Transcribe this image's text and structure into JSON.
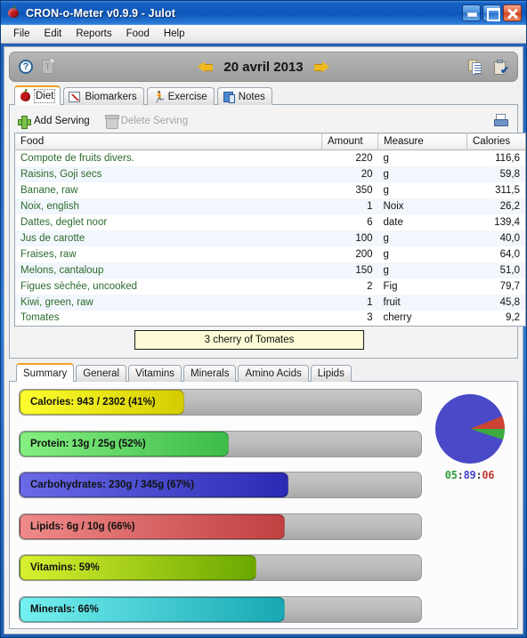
{
  "window": {
    "title": "CRON-o-Meter v0.9.9 - Julot",
    "icon": "apple-icon",
    "buttons": {
      "minimize": "minimize",
      "maximize": "maximize",
      "close": "close"
    }
  },
  "menubar": {
    "items": [
      "File",
      "Edit",
      "Reports",
      "Food",
      "Help"
    ]
  },
  "toolbar": {
    "help_icon": "?",
    "note_icon": "T",
    "prev_label": "previous-day",
    "next_label": "next-day",
    "date": "20 avril 2013",
    "copy_icon": "copy-icon",
    "paste_icon": "paste-icon"
  },
  "top_tabs": [
    {
      "label": "Diet",
      "icon": "apple-icon",
      "active": true
    },
    {
      "label": "Biomarkers",
      "icon": "chart-icon",
      "active": false
    },
    {
      "label": "Exercise",
      "icon": "runner-icon",
      "active": false
    },
    {
      "label": "Notes",
      "icon": "note-icon",
      "active": false
    }
  ],
  "serving_toolbar": {
    "add_label": "Add Serving",
    "delete_label": "Delete Serving",
    "delete_enabled": false,
    "print_icon": "print-icon"
  },
  "food_table": {
    "columns": [
      "Food",
      "Amount",
      "Measure",
      "Calories"
    ],
    "rows": [
      {
        "food": "Compote de fruits divers.",
        "amount": "220",
        "measure": "g",
        "calories": "116,6"
      },
      {
        "food": "Raisins, Goji secs",
        "amount": "20",
        "measure": "g",
        "calories": "59,8"
      },
      {
        "food": "Banane, raw",
        "amount": "350",
        "measure": "g",
        "calories": "311,5"
      },
      {
        "food": "Noix, english",
        "amount": "1",
        "measure": "Noix",
        "calories": "26,2"
      },
      {
        "food": "Dattes, deglet noor",
        "amount": "6",
        "measure": "date",
        "calories": "139,4"
      },
      {
        "food": "Jus de carotte",
        "amount": "100",
        "measure": "g",
        "calories": "40,0"
      },
      {
        "food": "Fraises, raw",
        "amount": "200",
        "measure": "g",
        "calories": "64,0"
      },
      {
        "food": "Melons, cantaloup",
        "amount": "150",
        "measure": "g",
        "calories": "51,0"
      },
      {
        "food": "Figues sèchée, uncooked",
        "amount": "2",
        "measure": "Fig",
        "calories": "79,7"
      },
      {
        "food": "Kiwi, green, raw",
        "amount": "1",
        "measure": "fruit",
        "calories": "45,8"
      },
      {
        "food": "Tomates",
        "amount": "3",
        "measure": "cherry",
        "calories": "9,2"
      }
    ]
  },
  "tooltip": {
    "text": "3 cherry of Tomates"
  },
  "bottom_tabs": [
    {
      "label": "Summary",
      "active": true
    },
    {
      "label": "General",
      "active": false
    },
    {
      "label": "Vitamins",
      "active": false
    },
    {
      "label": "Minerals",
      "active": false
    },
    {
      "label": "Amino Acids",
      "active": false
    },
    {
      "label": "Lipids",
      "active": false
    }
  ],
  "chart_data": {
    "type": "bar",
    "title": "Nutrient Targets Summary",
    "orientation": "horizontal",
    "xlabel": "",
    "ylabel": "",
    "xlim": [
      0,
      100
    ],
    "grid": false,
    "legend": false,
    "categories": [
      "Calories",
      "Protein",
      "Carbohydrates",
      "Lipids",
      "Vitamins",
      "Minerals"
    ],
    "values": [
      41,
      52,
      67,
      66,
      59,
      66
    ],
    "labels": [
      "Calories: 943 / 2302 (41%)",
      "Protein: 13g / 25g (52%)",
      "Carbohydrates: 230g / 345g (67%)",
      "Lipids: 6g / 10g (66%)",
      "Vitamins: 59%",
      "Minerals: 66%"
    ],
    "colors": [
      "#f2ec12",
      "#6ae063",
      "#4a4ad8",
      "#e06a6a",
      "#a8e018",
      "#4ad8d8"
    ],
    "bars": [
      {
        "name": "Calories",
        "current": 943,
        "target": 2302,
        "unit": "",
        "percent": 41,
        "label": "Calories: 943 / 2302 (41%)",
        "color_start": "#fdfd30",
        "color_end": "#d4cc00"
      },
      {
        "name": "Protein",
        "current": 13,
        "target": 25,
        "unit": "g",
        "percent": 52,
        "label": "Protein: 13g / 25g (52%)",
        "color_start": "#86f082",
        "color_end": "#3dbb4a"
      },
      {
        "name": "Carbohydrates",
        "current": 230,
        "target": 345,
        "unit": "g",
        "percent": 67,
        "label": "Carbohydrates: 230g / 345g (67%)",
        "color_start": "#6a6ae8",
        "color_end": "#2a2ab4"
      },
      {
        "name": "Lipids",
        "current": 6,
        "target": 10,
        "unit": "g",
        "percent": 66,
        "label": "Lipids: 6g / 10g (66%)",
        "color_start": "#f08a8a",
        "color_end": "#c04040"
      },
      {
        "name": "Vitamins",
        "current": 59,
        "target": 100,
        "unit": "%",
        "percent": 59,
        "label": "Vitamins: 59%",
        "color_start": "#d8f030",
        "color_end": "#6aa800"
      },
      {
        "name": "Minerals",
        "current": 66,
        "target": 100,
        "unit": "%",
        "percent": 66,
        "label": "Minerals: 66%",
        "color_start": "#74f0f0",
        "color_end": "#18a8b4"
      }
    ]
  },
  "pie_chart": {
    "type": "pie",
    "slices": [
      {
        "name": "Protein",
        "value": 5,
        "color": "#3caa40"
      },
      {
        "name": "Carbohydrates",
        "value": 89,
        "color": "#4a4ac8"
      },
      {
        "name": "Lipids",
        "value": 6,
        "color": "#cc4433"
      }
    ],
    "label_parts": [
      {
        "text": "05",
        "color": "#2f9a35"
      },
      {
        "text": ":",
        "color": "#444444"
      },
      {
        "text": "89",
        "color": "#4646c8"
      },
      {
        "text": ":",
        "color": "#444444"
      },
      {
        "text": "06",
        "color": "#c03a32"
      }
    ],
    "label": "05:89:06"
  }
}
